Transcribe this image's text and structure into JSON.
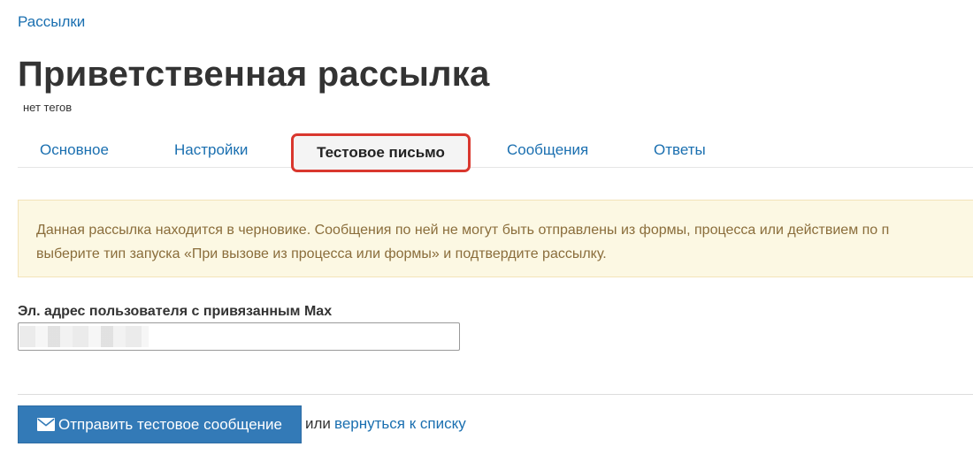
{
  "breadcrumb": {
    "label": "Рассылки"
  },
  "page": {
    "title": "Приветственная рассылка",
    "tags": "нет тегов"
  },
  "tabs": {
    "main": "Основное",
    "settings": "Настройки",
    "test_email": "Тестовое письмо",
    "messages": "Сообщения",
    "answers": "Ответы",
    "active": "test_email"
  },
  "alert": {
    "line1": "Данная рассылка находится в черновике. Сообщения по ней не могут быть отправлены из формы, процесса или действием по п",
    "line2": "выберите тип запуска «При вызове из процесса или формы» и подтвердите рассылку."
  },
  "form": {
    "email_label": "Эл. адрес пользователя с привязанным Max",
    "email_value": ""
  },
  "actions": {
    "send_label": "Отправить тестовое сообщение",
    "or_text": "или",
    "back_label": "вернуться к списку"
  },
  "colors": {
    "link": "#1a6fb0",
    "primary_button": "#337ab7",
    "active_tab_border": "#d9372e",
    "alert_background": "#fcf8e3",
    "alert_text": "#8a6d3b"
  },
  "icons": {
    "send_button_icon": "envelope-icon"
  }
}
